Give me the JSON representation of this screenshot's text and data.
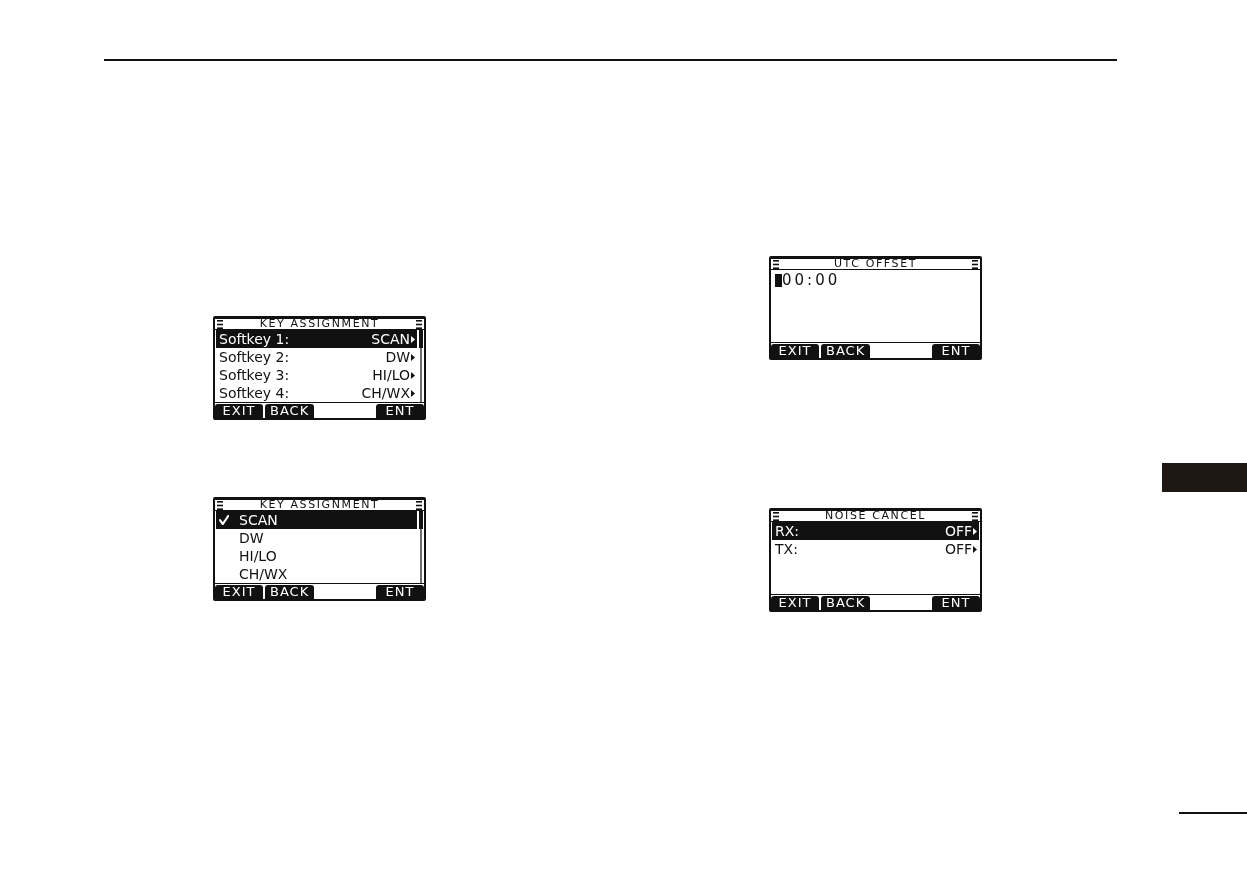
{
  "columns": [
    {
      "screens": [
        {
          "kind": "list",
          "title": "KEY ASSIGNMENT",
          "scrollable": true,
          "rows": [
            {
              "label": "Softkey 1:",
              "value": "SCAN",
              "selected": true
            },
            {
              "label": "Softkey 2:",
              "value": "DW",
              "selected": false
            },
            {
              "label": "Softkey 3:",
              "value": "HI/LO",
              "selected": false
            },
            {
              "label": "Softkey 4:",
              "value": "CH/WX",
              "selected": false
            }
          ],
          "softkeys": {
            "left": [
              "EXIT",
              "BACK"
            ],
            "right": [
              "ENT"
            ]
          }
        },
        {
          "kind": "options",
          "title": "KEY ASSIGNMENT",
          "scrollable": true,
          "rows": [
            {
              "label": "SCAN",
              "checked": true,
              "selected": true
            },
            {
              "label": "DW",
              "checked": false,
              "selected": false
            },
            {
              "label": "HI/LO",
              "checked": false,
              "selected": false
            },
            {
              "label": "CH/WX",
              "checked": false,
              "selected": false
            }
          ],
          "softkeys": {
            "left": [
              "EXIT",
              "BACK"
            ],
            "right": [
              "ENT"
            ]
          }
        }
      ]
    },
    {
      "screens": [
        {
          "kind": "entry",
          "title": "UTC OFFSET",
          "value": "00:00",
          "softkeys": {
            "left": [
              "EXIT",
              "BACK"
            ],
            "right": [
              "ENT"
            ]
          }
        },
        {
          "kind": "list",
          "title": "NOISE CANCEL",
          "scrollable": false,
          "rows": [
            {
              "label": "RX:",
              "value": "OFF",
              "selected": true
            },
            {
              "label": "TX:",
              "value": "OFF",
              "selected": false
            }
          ],
          "softkeys": {
            "left": [
              "EXIT",
              "BACK"
            ],
            "right": [
              "ENT"
            ]
          }
        }
      ]
    }
  ]
}
